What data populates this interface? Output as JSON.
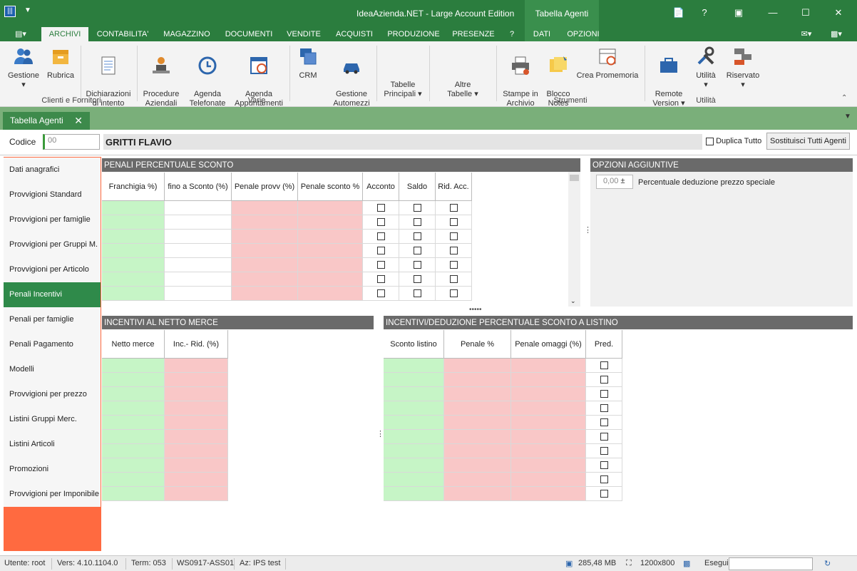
{
  "titlebar": {
    "title": "IdeaAzienda.NET - Large Account Edition",
    "context_tab": "Tabella Agenti",
    "help": "?"
  },
  "menu": {
    "tabs": [
      "ARCHIVI",
      "CONTABILITA'",
      "MAGAZZINO",
      "DOCUMENTI",
      "VENDITE",
      "ACQUISTI",
      "PRODUZIONE",
      "PRESENZE",
      "?"
    ],
    "context_tabs": [
      "DATI",
      "OPZIONI"
    ]
  },
  "ribbon": {
    "buttons": [
      {
        "label": "Gestione",
        "icon": "users-icon"
      },
      {
        "label": "Rubrica",
        "icon": "box-icon"
      },
      {
        "label": "Dichiarazioni\ndi intento",
        "icon": "document-icon"
      },
      {
        "label": "Procedure\nAziendali",
        "icon": "person-desk-icon"
      },
      {
        "label": "Agenda\nTelefonate",
        "icon": "history-icon"
      },
      {
        "label": "Agenda\nAppuntamenti",
        "icon": "calendar-clock-icon"
      },
      {
        "label": "CRM",
        "icon": "crm-icon"
      },
      {
        "label": "Gestione\nAutomezzi",
        "icon": "car-icon"
      },
      {
        "label": "Tabelle\nPrincipali",
        "icon": "none"
      },
      {
        "label": "Altre\nTabelle",
        "icon": "none"
      },
      {
        "label": "Stampe in\nArchivio",
        "icon": "printer-icon"
      },
      {
        "label": "Blocco\nNotes",
        "icon": "sticky-note-icon"
      },
      {
        "label": "Crea Promemoria",
        "icon": "calendar-alarm-icon"
      },
      {
        "label": "Remote\nVersion",
        "icon": "briefcase-icon"
      },
      {
        "label": "Utilità",
        "icon": "tools-icon"
      },
      {
        "label": "Riservato",
        "icon": "blocks-icon"
      }
    ],
    "groups": [
      "Clienti e Fornitori",
      "Varie",
      "Strumenti",
      "Utilità"
    ]
  },
  "doc_tab": {
    "label": "Tabella Agenti"
  },
  "header": {
    "codice_label": "Codice",
    "codice_value": "00",
    "name": "GRITTI FLAVIO",
    "duplica_label": "Duplica Tutto",
    "sostituisci_label": "Sostituisci Tutti Agenti"
  },
  "nav": {
    "items": [
      "Dati anagrafici",
      "Provvigioni Standard",
      "Provvigioni per famiglie",
      "Provvigioni per Gruppi M.",
      "Provvigioni per Articolo",
      "Penali Incentivi",
      "Penali per famiglie",
      "Penali Pagamento",
      "Modelli",
      "Provvigioni per prezzo",
      "Listini Gruppi Merc.",
      "Listini Articoli",
      "Promozioni",
      "Provvigioni per Imponibile"
    ],
    "selected": "Penali Incentivi"
  },
  "penali": {
    "title": "PENALI PERCENTUALE SCONTO",
    "columns": [
      "Franchigia %)",
      "fino a Sconto (%)",
      "Penale provv (%)",
      "Penale sconto %",
      "Acconto",
      "Saldo",
      "Rid. Acc."
    ]
  },
  "opzioni": {
    "title": "OPZIONI AGGIUNTIVE",
    "spin_value": "0,00",
    "spin_label": "Percentuale deduzione prezzo speciale"
  },
  "incentivi_netto": {
    "title": "INCENTIVI AL NETTO MERCE",
    "columns": [
      "Netto merce",
      "Inc.- Rid. (%)"
    ]
  },
  "incentivi_listino": {
    "title": "INCENTIVI/DEDUZIONE PERCENTUALE SCONTO A LISTINO",
    "columns": [
      "Sconto listino",
      "Penale %",
      "Penale omaggi (%)",
      "Pred."
    ]
  },
  "status": {
    "utente": "Utente: root",
    "vers": "Vers: 4.10.1104.0",
    "term": "Term: 053",
    "ws": "WS0917-ASS01",
    "az": "Az: IPS test",
    "mem": "285,48 MB",
    "res": "1200x800",
    "esegui": "Esegui"
  },
  "colors": {
    "brand": "#2b7d3e",
    "nav_accent": "#ff6a40",
    "green_cell": "#c6f5c6",
    "pink_cell": "#f9c7c7"
  }
}
